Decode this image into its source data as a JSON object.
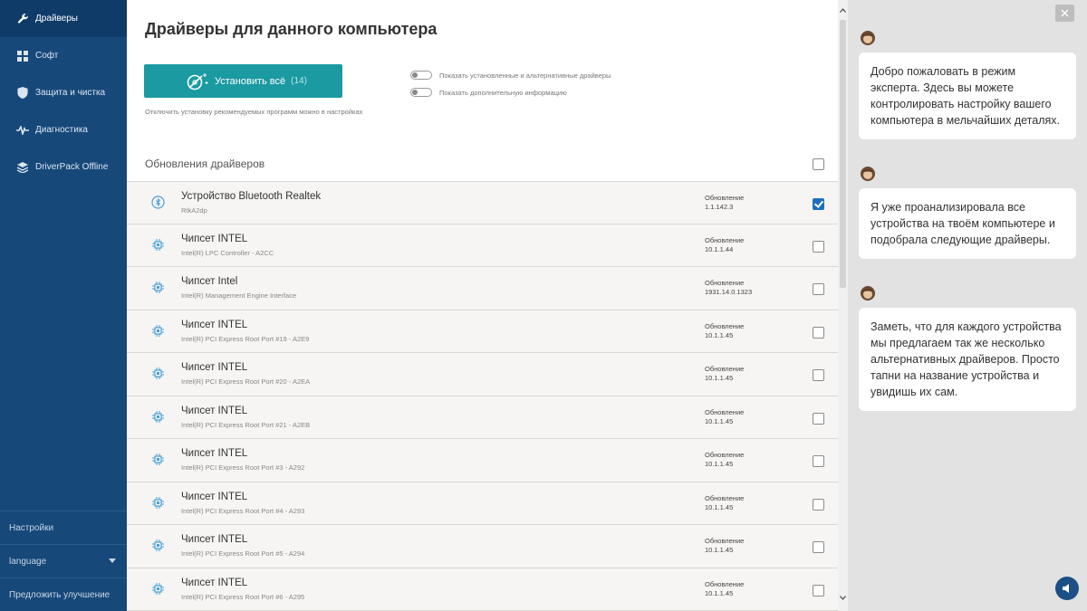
{
  "sidebar": {
    "items": [
      {
        "label": "Драйверы",
        "icon": "wrench-icon",
        "active": true
      },
      {
        "label": "Софт",
        "icon": "grid-icon",
        "active": false
      },
      {
        "label": "Защита и чистка",
        "icon": "shield-icon",
        "active": false
      },
      {
        "label": "Диагностика",
        "icon": "pulse-icon",
        "active": false
      },
      {
        "label": "DriverPack Offline",
        "icon": "layers-icon",
        "active": false
      }
    ],
    "bottom": {
      "settings": "Настройки",
      "language": "language",
      "suggest": "Предложить улучшение"
    }
  },
  "main": {
    "title": "Драйверы для данного компьютера",
    "install": {
      "label": "Установить всё",
      "count": "(14)"
    },
    "install_note": "Отключить установку рекомендуемых программ можно в настройках",
    "toggles": [
      {
        "label": "Показать установленные и альтернативные драйверы",
        "on": false
      },
      {
        "label": "Показать дополнительную информацию",
        "on": false
      }
    ],
    "section_title": "Обновления драйверов",
    "update_label": "Обновление",
    "drivers": [
      {
        "name": "Устройство Bluetooth Realtek",
        "sub": "RtkA2dp",
        "version": "1.1.142.3",
        "checked": true,
        "icon": "bluetooth-icon"
      },
      {
        "name": "Чипсет INTEL",
        "sub": "Intel(R) LPC Controller - A2CC",
        "version": "10.1.1.44",
        "checked": false,
        "icon": "chip-icon"
      },
      {
        "name": "Чипсет Intel",
        "sub": "Intel(R) Management Engine Interface",
        "version": "1931.14.0.1323",
        "checked": false,
        "icon": "chip-icon"
      },
      {
        "name": "Чипсет INTEL",
        "sub": "Intel(R) PCI Express Root Port #19 - A2E9",
        "version": "10.1.1.45",
        "checked": false,
        "icon": "chip-icon"
      },
      {
        "name": "Чипсет INTEL",
        "sub": "Intel(R) PCI Express Root Port #20 - A2EA",
        "version": "10.1.1.45",
        "checked": false,
        "icon": "chip-icon"
      },
      {
        "name": "Чипсет INTEL",
        "sub": "Intel(R) PCI Express Root Port #21 - A2EB",
        "version": "10.1.1.45",
        "checked": false,
        "icon": "chip-icon"
      },
      {
        "name": "Чипсет INTEL",
        "sub": "Intel(R) PCI Express Root Port #3 - A292",
        "version": "10.1.1.45",
        "checked": false,
        "icon": "chip-icon"
      },
      {
        "name": "Чипсет INTEL",
        "sub": "Intel(R) PCI Express Root Port #4 - A293",
        "version": "10.1.1.45",
        "checked": false,
        "icon": "chip-icon"
      },
      {
        "name": "Чипсет INTEL",
        "sub": "Intel(R) PCI Express Root Port #5 - A294",
        "version": "10.1.1.45",
        "checked": false,
        "icon": "chip-icon"
      },
      {
        "name": "Чипсет INTEL",
        "sub": "Intel(R) PCI Express Root Port #6 - A295",
        "version": "10.1.1.45",
        "checked": false,
        "icon": "chip-icon"
      }
    ]
  },
  "assistant": {
    "messages": [
      "Добро пожаловать в режим эксперта. Здесь вы можете контролировать настройку вашего компьютера в мельчайших деталях.",
      "Я уже проанализировала все устройства на твоём компьютере и подобрала следующие драйверы.",
      "Заметь, что для каждого устройства мы предлагаем так же несколько альтернативных драйверов. Просто тапни на название устройства и увидишь их сам."
    ]
  },
  "colors": {
    "sidebar": "#17487a",
    "accent": "#1b9aa2",
    "checkbox": "#1f6fbd",
    "row_icon": "#4a9fd8"
  }
}
